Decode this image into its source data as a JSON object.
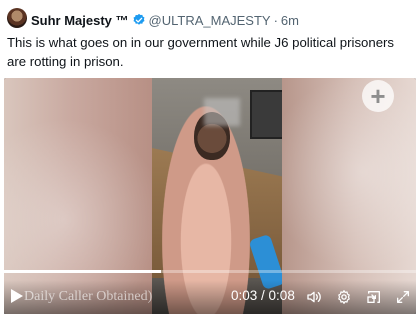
{
  "author": {
    "name": "Suhr Majesty ™",
    "handle": "@ULTRA_MAJESTY",
    "separator": "·",
    "time": "6m"
  },
  "tweet": {
    "text": "This is what goes on in our government while J6 political prisoners are rotting in prison."
  },
  "video": {
    "add_symbol": "+",
    "watermark_caption": "Daily Caller Obtained)",
    "current_time": "0:03",
    "duration": "0:08",
    "time_separator": " / ",
    "progress": 0.38
  },
  "icons": {
    "verified": "verified-badge-icon",
    "play": "play-icon",
    "volume": "volume-icon",
    "settings": "settings-icon",
    "pip": "picture-in-picture-icon",
    "fullscreen": "fullscreen-icon"
  },
  "colors": {
    "verified_blue": "#1d9bf0",
    "text_secondary": "#536471",
    "text_primary": "#0f1419"
  }
}
